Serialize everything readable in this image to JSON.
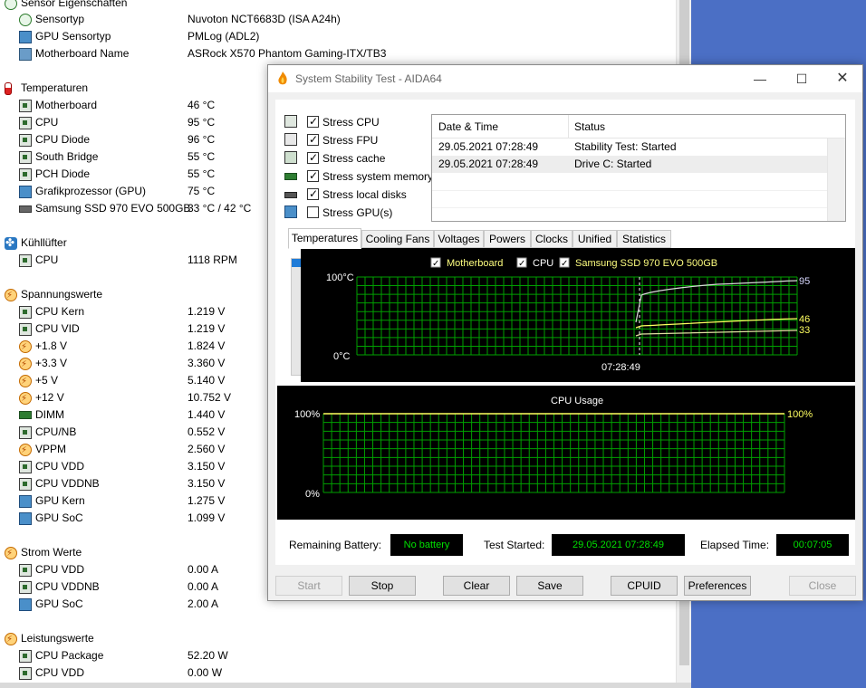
{
  "sensor_panel": {
    "partial_top": "Sensor Eigenschaften",
    "properties": [
      {
        "label": "Sensortyp",
        "value": "Nuvoton NCT6683D  (ISA A24h)",
        "icon": "sensor-icon"
      },
      {
        "label": "GPU Sensortyp",
        "value": "PMLog  (ADL2)",
        "icon": "gpu-icon"
      },
      {
        "label": "Motherboard Name",
        "value": "ASRock X570 Phantom Gaming-ITX/TB3",
        "icon": "motherboard-icon"
      }
    ],
    "temperaturen": {
      "title": "Temperaturen",
      "items": [
        {
          "label": "Motherboard",
          "value": "46 °C",
          "icon": "chip-icon"
        },
        {
          "label": "CPU",
          "value": "95 °C",
          "icon": "chip-icon"
        },
        {
          "label": "CPU Diode",
          "value": "96 °C",
          "icon": "chip-icon"
        },
        {
          "label": "South Bridge",
          "value": "55 °C",
          "icon": "chip-icon"
        },
        {
          "label": "PCH Diode",
          "value": "55 °C",
          "icon": "chip-icon"
        },
        {
          "label": "Grafikprozessor (GPU)",
          "value": "75 °C",
          "icon": "gpu-icon"
        },
        {
          "label": "Samsung SSD 970 EVO 500GB",
          "value": "33 °C / 42 °C",
          "icon": "ssd-icon"
        }
      ]
    },
    "kuehlluefter": {
      "title": "Kühllüfter",
      "items": [
        {
          "label": "CPU",
          "value": "1118 RPM",
          "icon": "chip-icon"
        }
      ]
    },
    "spannungswerte": {
      "title": "Spannungswerte",
      "items": [
        {
          "label": "CPU Kern",
          "value": "1.219 V",
          "icon": "chip-icon"
        },
        {
          "label": "CPU VID",
          "value": "1.219 V",
          "icon": "chip-icon"
        },
        {
          "label": "+1.8 V",
          "value": "1.824 V",
          "icon": "voltage-icon"
        },
        {
          "label": "+3.3 V",
          "value": "3.360 V",
          "icon": "voltage-icon"
        },
        {
          "label": "+5 V",
          "value": "5.140 V",
          "icon": "voltage-icon"
        },
        {
          "label": "+12 V",
          "value": "10.752 V",
          "icon": "voltage-icon"
        },
        {
          "label": "DIMM",
          "value": "1.440 V",
          "icon": "dimm-icon"
        },
        {
          "label": "CPU/NB",
          "value": "0.552 V",
          "icon": "chip-icon"
        },
        {
          "label": "VPPM",
          "value": "2.560 V",
          "icon": "voltage-icon"
        },
        {
          "label": "CPU VDD",
          "value": "3.150 V",
          "icon": "chip-icon"
        },
        {
          "label": "CPU VDDNB",
          "value": "3.150 V",
          "icon": "chip-icon"
        },
        {
          "label": "GPU Kern",
          "value": "1.275 V",
          "icon": "gpu-icon"
        },
        {
          "label": "GPU SoC",
          "value": "1.099 V",
          "icon": "gpu-icon"
        }
      ]
    },
    "strom_werte": {
      "title": "Strom Werte",
      "items": [
        {
          "label": "CPU VDD",
          "value": "0.00 A",
          "icon": "chip-icon"
        },
        {
          "label": "CPU VDDNB",
          "value": "0.00 A",
          "icon": "chip-icon"
        },
        {
          "label": "GPU SoC",
          "value": "2.00 A",
          "icon": "gpu-icon"
        }
      ]
    },
    "leistungswerte": {
      "title": "Leistungswerte",
      "items": [
        {
          "label": "CPU Package",
          "value": "52.20 W",
          "icon": "chip-icon"
        },
        {
          "label": "CPU VDD",
          "value": "0.00 W",
          "icon": "chip-icon"
        }
      ]
    }
  },
  "dialog": {
    "title": "System Stability Test - AIDA64",
    "stress_options": [
      {
        "label": "Stress CPU",
        "checked": true,
        "icon": "cpu-icon"
      },
      {
        "label": "Stress FPU",
        "checked": true,
        "icon": "fpu-icon"
      },
      {
        "label": "Stress cache",
        "checked": true,
        "icon": "cache-icon"
      },
      {
        "label": "Stress system memory",
        "checked": true,
        "icon": "memory-icon"
      },
      {
        "label": "Stress local disks",
        "checked": true,
        "icon": "disk-icon"
      },
      {
        "label": "Stress GPU(s)",
        "checked": false,
        "icon": "gpu-icon"
      }
    ],
    "log": {
      "headers": [
        "Date & Time",
        "Status"
      ],
      "rows": [
        {
          "datetime": "29.05.2021 07:28:49",
          "status": "Stability Test: Started"
        },
        {
          "datetime": "29.05.2021 07:28:49",
          "status": "Drive C: Started"
        }
      ]
    },
    "tabs": [
      "Temperatures",
      "Cooling Fans",
      "Voltages",
      "Powers",
      "Clocks",
      "Unified",
      "Statistics"
    ],
    "active_tab": "Temperatures",
    "temp_graph": {
      "legend": [
        {
          "label": "Motherboard",
          "color": "#ffff80",
          "checked": true
        },
        {
          "label": "CPU",
          "color": "#ffffff",
          "checked": true
        },
        {
          "label": "Samsung SSD 970 EVO 500GB",
          "color": "#ffff80",
          "checked": true
        }
      ],
      "ymax_label": "100°C",
      "ymin_label": "0°C",
      "time_label": "07:28:49",
      "grid_color": "#00a000",
      "values": {
        "cpu": "95",
        "motherboard": "46",
        "ssd": "33"
      }
    },
    "cpu_graph": {
      "title": "CPU Usage",
      "ymax_label": "100%",
      "ymin_label": "0%",
      "current_label": "100%"
    },
    "status": {
      "battery_label": "Remaining Battery:",
      "battery_value": "No battery",
      "started_label": "Test Started:",
      "started_value": "29.05.2021 07:28:49",
      "elapsed_label": "Elapsed Time:",
      "elapsed_value": "00:07:05"
    },
    "buttons": {
      "start": "Start",
      "stop": "Stop",
      "clear": "Clear",
      "save": "Save",
      "cpuid": "CPUID",
      "preferences": "Preferences",
      "close": "Close"
    }
  }
}
